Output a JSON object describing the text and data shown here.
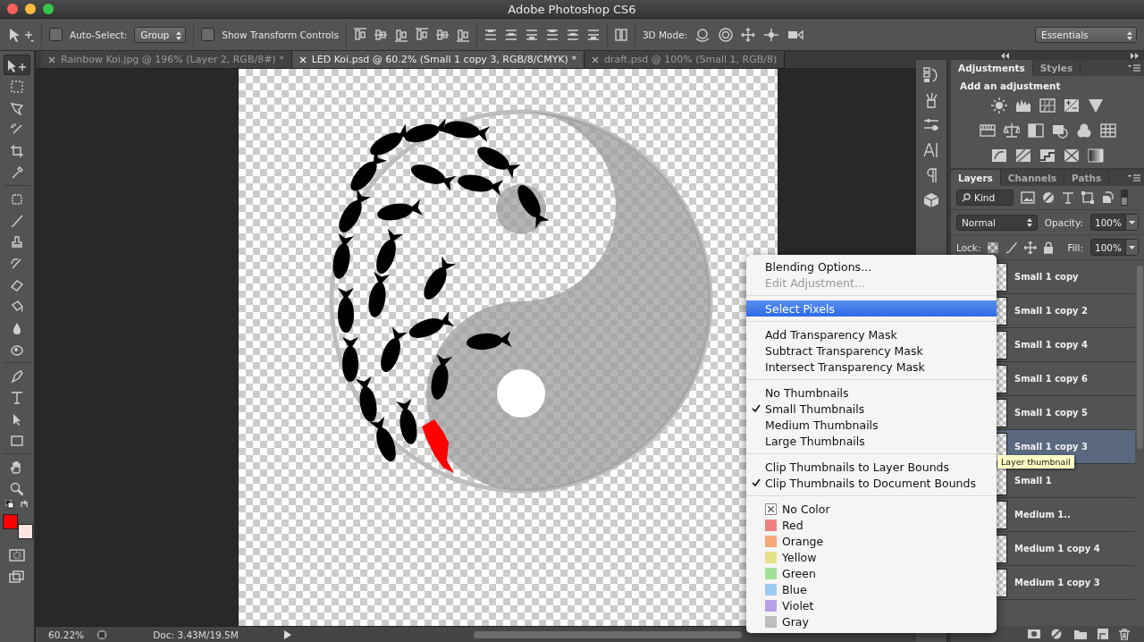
{
  "window": {
    "title": "Adobe Photoshop CS6"
  },
  "options_bar": {
    "auto_select": {
      "label": "Auto-Select:",
      "checked": false
    },
    "auto_select_target": "Group",
    "show_transform_controls": {
      "label": "Show Transform Controls",
      "checked": false
    },
    "mode_3d_label": "3D Mode:",
    "workspace": "Essentials"
  },
  "document_tabs": [
    {
      "label": "Rainbow Koi.jpg @ 196% (Layer 2, RGB/8#) *",
      "selected": false
    },
    {
      "label": "LED Koi.psd @ 60.2% (Small 1 copy 3, RGB/8/CMYK) *",
      "selected": true
    },
    {
      "label": "draft.psd @ 100% (Small 1, RGB/8)",
      "selected": false
    }
  ],
  "tools": [
    {
      "selected": true
    },
    {
      "selected": false
    },
    {
      "selected": false
    },
    {
      "selected": false
    },
    {
      "selected": false
    },
    {
      "selected": false
    },
    {
      "selected": false
    },
    {
      "selected": false
    },
    {
      "selected": false
    },
    {
      "selected": false
    },
    {
      "selected": false
    },
    {
      "selected": false
    },
    {
      "selected": false
    },
    {
      "selected": false
    },
    {
      "selected": false
    },
    {
      "selected": false
    },
    {
      "selected": false
    },
    {
      "selected": false
    },
    {
      "selected": false
    },
    {
      "selected": false
    }
  ],
  "swatches": [
    {
      "kind": "foreground",
      "color": "#ff0000"
    },
    {
      "kind": "background",
      "color": "#ffe4e4"
    }
  ],
  "status_bar": {
    "zoom": "60.22%",
    "doc_info": "Doc: 3.43M/19.5M"
  },
  "adjustments_panel": {
    "tabs": [
      {
        "label": "Adjustments",
        "selected": true
      },
      {
        "label": "Styles",
        "selected": false
      }
    ],
    "heading": "Add an adjustment"
  },
  "layers_panel": {
    "tabs": [
      {
        "label": "Layers",
        "selected": true
      },
      {
        "label": "Channels",
        "selected": false
      },
      {
        "label": "Paths",
        "selected": false
      }
    ],
    "filter": "Kind",
    "blend_mode": "Normal",
    "opacity_label": "Opacity:",
    "opacity": "100%",
    "lock_label": "Lock:",
    "fill_label": "Fill:",
    "fill": "100%",
    "layers": [
      {
        "name": "Small 1 copy",
        "selected": false
      },
      {
        "name": "Small 1 copy 2",
        "selected": false
      },
      {
        "name": "Small 1 copy 4",
        "selected": false
      },
      {
        "name": "Small 1 copy 6",
        "selected": false
      },
      {
        "name": "Small 1 copy 5",
        "selected": false
      },
      {
        "name": "Small 1 copy 3",
        "selected": true
      },
      {
        "name": "Small 1",
        "selected": false
      },
      {
        "name": "Medium 1..",
        "selected": false
      },
      {
        "name": "Medium 1 copy 4",
        "selected": false
      },
      {
        "name": "Medium 1 copy 3",
        "selected": false
      }
    ]
  },
  "context_menu": {
    "groups": [
      {
        "items": [
          {
            "kind": "command",
            "label": "Blending Options...",
            "disabled": false,
            "selected": false,
            "checked": false
          },
          {
            "kind": "command",
            "label": "Edit Adjustment...",
            "disabled": true,
            "selected": false,
            "checked": false
          }
        ]
      },
      {
        "items": [
          {
            "kind": "command",
            "label": "Select Pixels",
            "disabled": false,
            "selected": true,
            "checked": false
          }
        ]
      },
      {
        "items": [
          {
            "kind": "command",
            "label": "Add Transparency Mask",
            "disabled": false,
            "selected": false,
            "checked": false
          },
          {
            "kind": "command",
            "label": "Subtract Transparency Mask",
            "disabled": false,
            "selected": false,
            "checked": false
          },
          {
            "kind": "command",
            "label": "Intersect Transparency Mask",
            "disabled": false,
            "selected": false,
            "checked": false
          }
        ]
      },
      {
        "items": [
          {
            "kind": "command",
            "label": "No Thumbnails",
            "disabled": false,
            "selected": false,
            "checked": false
          },
          {
            "kind": "command",
            "label": "Small Thumbnails",
            "disabled": false,
            "selected": false,
            "checked": true
          },
          {
            "kind": "command",
            "label": "Medium Thumbnails",
            "disabled": false,
            "selected": false,
            "checked": false
          },
          {
            "kind": "command",
            "label": "Large Thumbnails",
            "disabled": false,
            "selected": false,
            "checked": false
          }
        ]
      },
      {
        "items": [
          {
            "kind": "command",
            "label": "Clip Thumbnails to Layer Bounds",
            "disabled": false,
            "selected": false,
            "checked": false
          },
          {
            "kind": "command",
            "label": "Clip Thumbnails to Document Bounds",
            "disabled": false,
            "selected": false,
            "checked": true
          }
        ]
      },
      {
        "items": [
          {
            "kind": "no_color",
            "label": "No Color",
            "disabled": false,
            "selected": false,
            "checked": false
          },
          {
            "kind": "color",
            "label": "Red",
            "color": "#f08080",
            "disabled": false,
            "selected": false,
            "checked": false
          },
          {
            "kind": "color",
            "label": "Orange",
            "color": "#f5a878",
            "disabled": false,
            "selected": false,
            "checked": false
          },
          {
            "kind": "color",
            "label": "Yellow",
            "color": "#e6e08a",
            "disabled": false,
            "selected": false,
            "checked": false
          },
          {
            "kind": "color",
            "label": "Green",
            "color": "#a2e09a",
            "disabled": false,
            "selected": false,
            "checked": false
          },
          {
            "kind": "color",
            "label": "Blue",
            "color": "#9ccaf2",
            "disabled": false,
            "selected": false,
            "checked": false
          },
          {
            "kind": "color",
            "label": "Violet",
            "color": "#b8a0e8",
            "disabled": false,
            "selected": false,
            "checked": false
          },
          {
            "kind": "color",
            "label": "Gray",
            "color": "#bdbdbd",
            "disabled": false,
            "selected": false,
            "checked": false
          }
        ]
      }
    ]
  },
  "tooltip": "Layer thumbnail"
}
